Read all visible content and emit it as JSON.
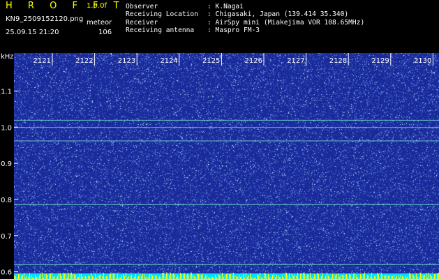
{
  "header": {
    "app_title": "H R O F F T",
    "version": "1.0.0f",
    "filename": "KN9_2509152120.png",
    "meteor_label": "meteor",
    "datetime": "25.09.15 21:20",
    "meteor_count": "106",
    "info": [
      {
        "key": "Observer",
        "value": ": K.Nagai"
      },
      {
        "key": "Receiving Location",
        "value": ": Chigasaki, Japan (139.414 35.340)"
      },
      {
        "key": "Receiver",
        "value": ": AirSpy mini (Miakejima VOR 108.65MHz)"
      },
      {
        "key": "Receiving antenna",
        "value": ": Maspro FM-3"
      }
    ]
  },
  "spectrogram": {
    "y_unit": "kHz",
    "y_ticks": [
      "1.1",
      "1.0",
      "0.9",
      "0.8",
      "0.7",
      "0.6"
    ],
    "x_ticks": [
      "2121",
      "2122",
      "2123",
      "2124",
      "2125",
      "2126",
      "2127",
      "2128",
      "2129",
      "2130"
    ],
    "y_range": [
      0.58,
      1.205
    ],
    "background_color": "#1a2a9a",
    "noise_color": "#b8e4ff",
    "line_color": "#70e0d0",
    "carrier_lines_khz": [
      1.019,
      0.999,
      0.962,
      0.786,
      0.62
    ],
    "footer_colors": [
      "#ffff00",
      "#00e0ff"
    ]
  }
}
